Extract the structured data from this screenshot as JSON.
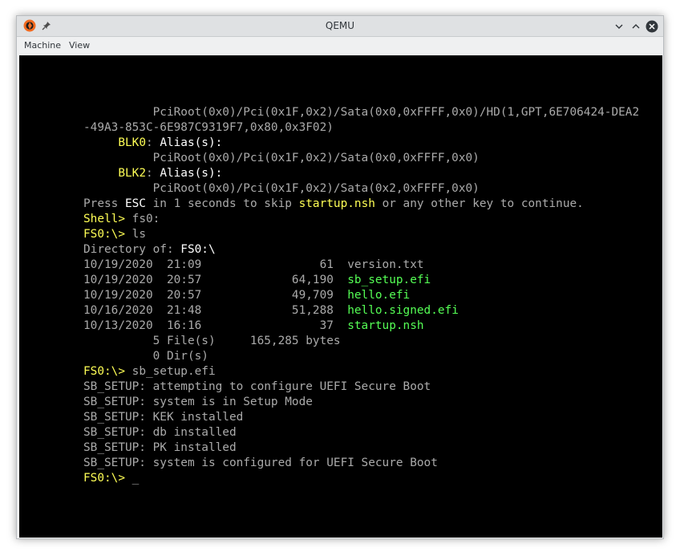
{
  "window": {
    "title": "QEMU",
    "menu": [
      "Machine",
      "View"
    ]
  },
  "console": [
    [
      {
        "t": "          PciRoot(0x0)/Pci(0x1F,0x2)/Sata(0x0,0xFFFF,0x0)/HD(1,GPT,6E706424-DEA2",
        "c": "n"
      }
    ],
    [
      {
        "t": "-49A3-853C-6E987C9319F7,0x80,0x3F02)",
        "c": "n"
      }
    ],
    [
      {
        "t": "     ",
        "c": "n"
      },
      {
        "t": "BLK0",
        "c": "y"
      },
      {
        "t": ": ",
        "c": "n"
      },
      {
        "t": "Alias(s):",
        "c": "w"
      }
    ],
    [
      {
        "t": "          PciRoot(0x0)/Pci(0x1F,0x2)/Sata(0x0,0xFFFF,0x0)",
        "c": "n"
      }
    ],
    [
      {
        "t": "     ",
        "c": "n"
      },
      {
        "t": "BLK2",
        "c": "y"
      },
      {
        "t": ": ",
        "c": "n"
      },
      {
        "t": "Alias(s):",
        "c": "w"
      }
    ],
    [
      {
        "t": "          PciRoot(0x0)/Pci(0x1F,0x2)/Sata(0x2,0xFFFF,0x0)",
        "c": "n"
      }
    ],
    [
      {
        "t": "Press ",
        "c": "n"
      },
      {
        "t": "ESC",
        "c": "w"
      },
      {
        "t": " in 1 seconds to skip ",
        "c": "n"
      },
      {
        "t": "startup.nsh",
        "c": "y"
      },
      {
        "t": " or any other key to continue.",
        "c": "n"
      }
    ],
    [
      {
        "t": "Shell> ",
        "c": "y"
      },
      {
        "t": "fs0:",
        "c": "n"
      }
    ],
    [
      {
        "t": "FS0:\\> ",
        "c": "y"
      },
      {
        "t": "ls",
        "c": "n"
      }
    ],
    [
      {
        "t": "Directory of: ",
        "c": "n"
      },
      {
        "t": "FS0:\\",
        "c": "w"
      }
    ],
    [
      {
        "t": "10/19/2020  21:09                 61  ",
        "c": "n"
      },
      {
        "t": "version.txt",
        "c": "n"
      }
    ],
    [
      {
        "t": "10/19/2020  20:57             64,190  ",
        "c": "n"
      },
      {
        "t": "sb_setup.efi",
        "c": "g"
      }
    ],
    [
      {
        "t": "10/19/2020  20:57             49,709  ",
        "c": "n"
      },
      {
        "t": "hello.efi",
        "c": "g"
      }
    ],
    [
      {
        "t": "10/16/2020  21:48             51,288  ",
        "c": "n"
      },
      {
        "t": "hello.signed.efi",
        "c": "g"
      }
    ],
    [
      {
        "t": "10/13/2020  16:16                 37  ",
        "c": "n"
      },
      {
        "t": "startup.nsh",
        "c": "g"
      }
    ],
    [
      {
        "t": "          5 File(s)     165,285 bytes",
        "c": "n"
      }
    ],
    [
      {
        "t": "          0 Dir(s)",
        "c": "n"
      }
    ],
    [
      {
        "t": "FS0:\\> ",
        "c": "y"
      },
      {
        "t": "sb_setup.efi",
        "c": "n"
      }
    ],
    [
      {
        "t": "SB_SETUP: attempting to configure UEFI Secure Boot",
        "c": "n"
      }
    ],
    [
      {
        "t": "SB_SETUP: system is in Setup Mode",
        "c": "n"
      }
    ],
    [
      {
        "t": "SB_SETUP: KEK installed",
        "c": "n"
      }
    ],
    [
      {
        "t": "SB_SETUP: db installed",
        "c": "n"
      }
    ],
    [
      {
        "t": "SB_SETUP: PK installed",
        "c": "n"
      }
    ],
    [
      {
        "t": "SB_SETUP: system is configured for UEFI Secure Boot",
        "c": "n"
      }
    ],
    [
      {
        "t": "FS0:\\> ",
        "c": "y"
      },
      {
        "t": "_",
        "c": "cursor"
      }
    ]
  ],
  "colors": {
    "default_text": "#aaaaaa",
    "yellow": "#ffff55",
    "white": "#ffffff",
    "green": "#55ff55",
    "screen_bg": "#000000"
  }
}
